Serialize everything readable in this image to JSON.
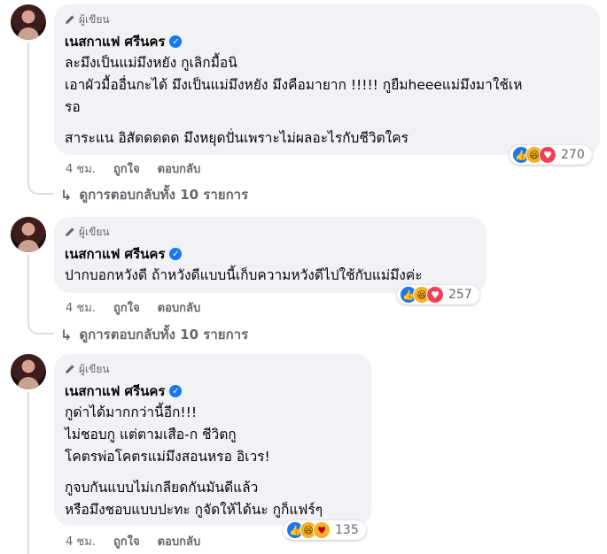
{
  "comments": [
    {
      "badge": "ผู้เขียน",
      "author": "เนสกาแฟ ศรีนคร",
      "lines": [
        "ละมึงเป็นแม่มึงหยัง กูเลิกมื้อนิ",
        "เอาผัวมื้ออื่นกะได้ มึงเป็นแม่มึงหยัง มึงคือมายาก !!!!! กูยืมheeeแม่มึงมาใช้เห",
        "รอ",
        "",
        "สาระแน อิสัดดดดด มึงหยุดปั่นเพราะไม่ผลอะไรกับชีวิตใคร"
      ],
      "reaction_count": "270",
      "time": "4 ชม.",
      "like": "ถูกใจ",
      "reply": "ตอบกลับ",
      "view_replies": "ดูการตอบกลับทั้ง 10 รายการ"
    },
    {
      "badge": "ผู้เขียน",
      "author": "เนสกาแฟ ศรีนคร",
      "lines": [
        "ปากบอกหวังดี ถ้าหวังดีแบบนี้เก็บความหวังดีไปใช้กับแม่มึงค่ะ"
      ],
      "reaction_count": "257",
      "time": "4 ชม.",
      "like": "ถูกใจ",
      "reply": "ตอบกลับ",
      "view_replies": "ดูการตอบกลับทั้ง 10 รายการ"
    },
    {
      "badge": "ผู้เขียน",
      "author": "เนสกาแฟ ศรีนคร",
      "lines": [
        "กูด่าได้มากกว่านี้อีก!!!",
        "ไม่ชอบกู แต่ตามเสือ-ก ชีวิตกู",
        "โคตรพ่อโคตรแม่มึงสอนหรอ อิเวร!",
        "",
        "กูจบกันแบบไม่เกลียดกันมันดีแล้ว",
        "หรือมึงชอบแบบปะทะ กูจัดให้ได้นะ กูก็แฟร์ๆ"
      ],
      "reaction_count": "135",
      "time": "4 ชม.",
      "like": "ถูกใจ",
      "reply": "ตอบกลับ"
    }
  ],
  "colors": {
    "bubble": "#f0f2f5",
    "muted": "#65676b",
    "verified": "#1877f2"
  }
}
